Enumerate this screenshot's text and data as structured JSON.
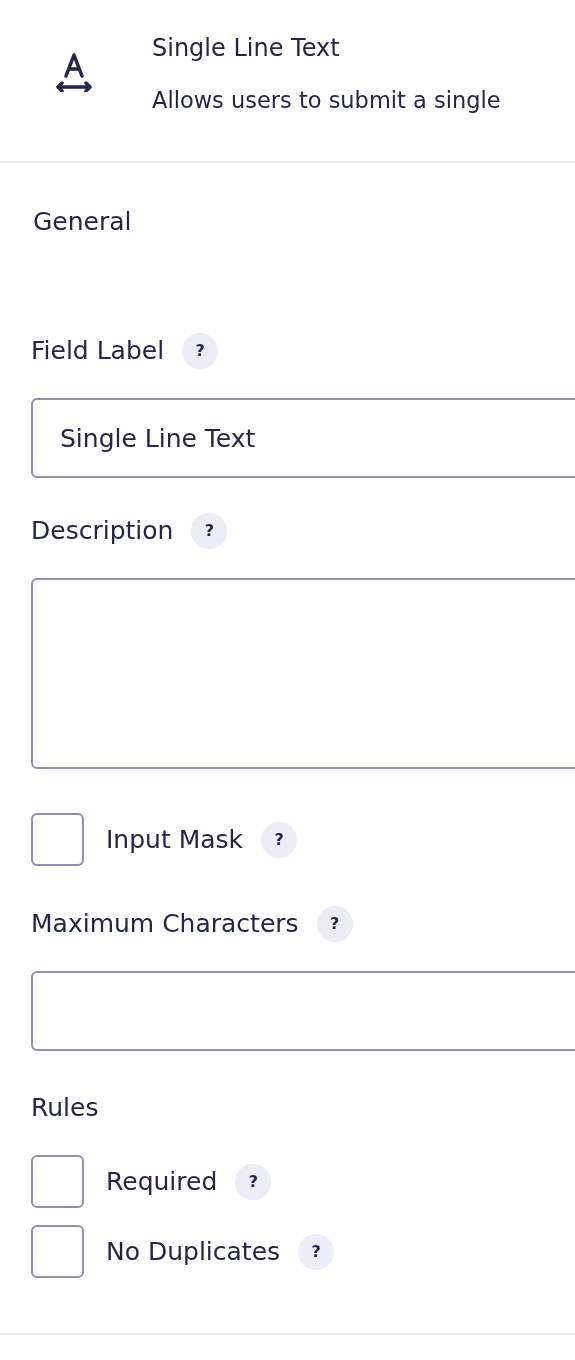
{
  "header": {
    "title": "Single Line Text",
    "description": "Allows users to submit a single"
  },
  "section": {
    "title": "General"
  },
  "fields": [
    {
      "kind": "text",
      "label": "Field Label",
      "help": "?",
      "value": "Single Line Text"
    },
    {
      "kind": "textarea",
      "label": "Description",
      "help": "?"
    },
    {
      "kind": "checkbox",
      "label": "Input Mask",
      "help": "?",
      "checked": false
    },
    {
      "kind": "text",
      "label": "Maximum Characters",
      "help": "?"
    }
  ],
  "rules": {
    "title": "Rules",
    "items": [
      {
        "label": "Required",
        "help": "?",
        "checked": false
      },
      {
        "label": "No Duplicates",
        "help": "?",
        "checked": false
      }
    ]
  }
}
